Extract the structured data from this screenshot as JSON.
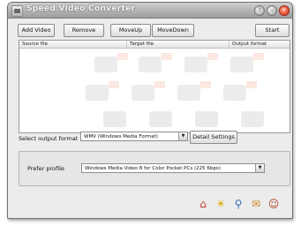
{
  "window": {
    "title": "Speed Video Converter"
  },
  "toolbar": {
    "add_video": "Add Video",
    "remove": "Remove",
    "move_up": "MoveUp",
    "move_down": "MoveDown",
    "start": "Start"
  },
  "file_list": {
    "columns": [
      "Source file",
      "Target file",
      "Output format"
    ]
  },
  "output": {
    "label": "Select output format",
    "selected": "WMV (Windows Media Format)",
    "details_button": "Detail Settings"
  },
  "profile": {
    "label": "Prefer profile",
    "selected": "Windows Media Video 8 for Color Pocket PCs (225 Kbps)"
  },
  "bottom_icons": [
    "home-icon",
    "lightbulb-icon",
    "search-icon",
    "envelope-icon",
    "user-icon"
  ]
}
